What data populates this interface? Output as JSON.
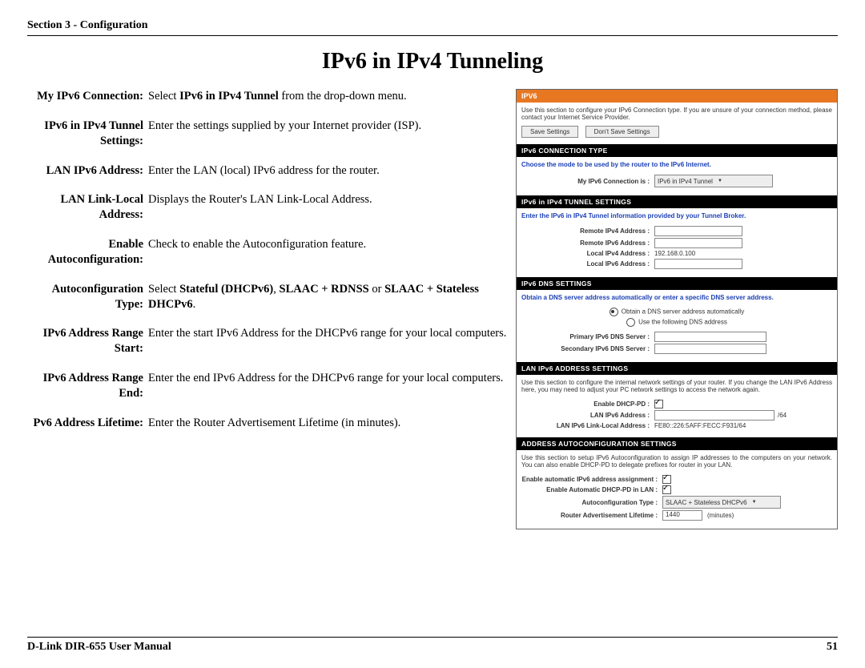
{
  "header": {
    "section": "Section 3 - Configuration"
  },
  "title": "IPv6 in IPv4 Tunneling",
  "defs": [
    {
      "term": "My IPv6 Connection:",
      "desc_pre": "Select ",
      "bold": "IPv6 in IPv4 Tunnel",
      "desc_post": " from the drop-down menu."
    },
    {
      "term": "IPv6 in IPv4 Tunnel Settings:",
      "desc": "Enter the settings supplied by your Internet provider (ISP)."
    },
    {
      "term": "LAN IPv6 Address:",
      "desc": "Enter the LAN (local) IPv6 address for the router."
    },
    {
      "term": "LAN Link-Local Address:",
      "desc": "Displays the Router's LAN Link-Local Address."
    },
    {
      "term": "Enable Autoconfiguration:",
      "desc": "Check to enable the Autoconfiguration feature."
    },
    {
      "term": "Autoconfiguration Type:",
      "desc_pre": "Select ",
      "bold": "Stateful (DHCPv6)",
      "mid1": ", ",
      "bold2": "SLAAC + RDNSS",
      "mid2": " or ",
      "bold3": "SLAAC + Stateless DHCPv6",
      "desc_post": "."
    },
    {
      "term": "IPv6 Address Range Start:",
      "desc": "Enter the start IPv6 Address for the DHCPv6 range for your local computers."
    },
    {
      "term": "IPv6 Address Range End:",
      "desc": "Enter the end IPv6 Address for the DHCPv6 range for your local computers."
    },
    {
      "term": "Pv6 Address Lifetime:",
      "desc": "Enter the Router Advertisement Lifetime (in minutes)."
    }
  ],
  "panel": {
    "ipv6_title": "IPV6",
    "ipv6_intro": "Use this section to configure your IPv6 Connection type. If you are unsure of your connection method, please contact your Internet Service Provider.",
    "btn_save": "Save Settings",
    "btn_dont": "Don't Save Settings",
    "conn_type_hdr": "IPv6 CONNECTION TYPE",
    "conn_blue": "Choose the mode to be used by the router to the IPv6 Internet.",
    "conn_label": "My IPv6 Connection is :",
    "conn_value": "IPv6 in IPv4 Tunnel",
    "tunnel_hdr": "IPv6 in IPv4 TUNNEL SETTINGS",
    "tunnel_blue": "Enter the IPv6 in IPv4 Tunnel information provided by your Tunnel Broker.",
    "t_remote4": "Remote IPv4 Address :",
    "t_remote6": "Remote IPv6 Address :",
    "t_local4": "Local IPv4 Address :",
    "t_local4_val": "192.168.0.100",
    "t_local6": "Local IPv6 Address :",
    "dns_hdr": "IPv6 DNS SETTINGS",
    "dns_blue": "Obtain a DNS server address automatically or enter a specific DNS server address.",
    "dns_auto": "Obtain a DNS server address automatically",
    "dns_manual": "Use the following DNS address",
    "dns_primary": "Primary IPv6 DNS Server :",
    "dns_secondary": "Secondary IPv6 DNS Server :",
    "lan_hdr": "LAN IPv6 ADDRESS SETTINGS",
    "lan_intro": "Use this section to configure the internal network settings of your router. If you change the LAN IPv6 Address here, you may need to adjust your PC network settings to access the network again.",
    "lan_dhcppd": "Enable DHCP-PD :",
    "lan_addr": "LAN IPv6 Address :",
    "lan_addr_suffix": "/64",
    "lan_ll": "LAN IPv6 Link-Local Address :",
    "lan_ll_val": "FE80::226:5AFF:FECC:F931/64",
    "auto_hdr": "ADDRESS AUTOCONFIGURATION SETTINGS",
    "auto_intro": "Use this section to setup IPv6 Autoconfiguration to assign IP addresses to the computers on your network. You can also enable DHCP-PD to delegate prefixes for router in your LAN.",
    "auto_enable": "Enable automatic IPv6 address assignment :",
    "auto_dhcppd": "Enable Automatic DHCP-PD in LAN :",
    "auto_type": "Autoconfiguration Type :",
    "auto_type_val": "SLAAC + Stateless DHCPv6",
    "auto_ra": "Router Advertisement Lifetime :",
    "auto_ra_val": "1440",
    "auto_ra_unit": "(minutes)"
  },
  "footer": {
    "manual": "D-Link DIR-655 User Manual",
    "page": "51"
  }
}
